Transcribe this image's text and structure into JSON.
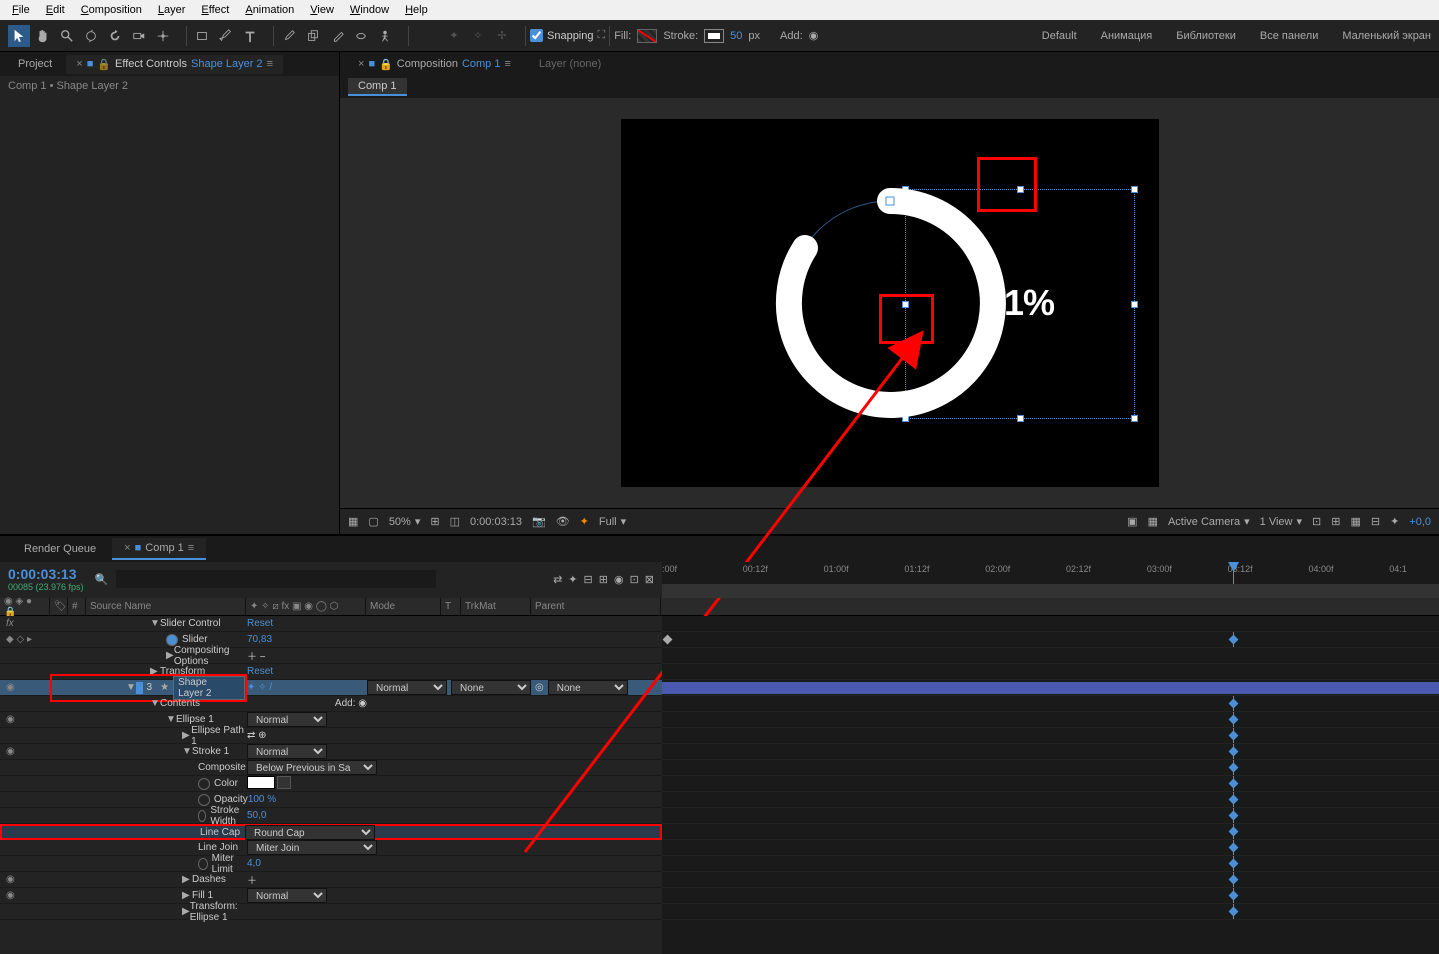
{
  "menu": [
    "File",
    "Edit",
    "Composition",
    "Layer",
    "Effect",
    "Animation",
    "View",
    "Window",
    "Help"
  ],
  "toolbar": {
    "snapping_label": "Snapping",
    "fill_label": "Fill:",
    "stroke_label": "Stroke:",
    "stroke_px": "50",
    "px_label": "px",
    "add_label": "Add:",
    "workspace_default": "Default",
    "ws": [
      "Анимация",
      "Библиотеки",
      "Все панели",
      "Маленький экран"
    ]
  },
  "project_panel": {
    "tabs": {
      "project": "Project",
      "effect_controls": "Effect Controls",
      "effect_target": "Shape Layer 2"
    },
    "subhead": "Comp 1 • Shape Layer 2"
  },
  "comp_panel": {
    "tab_prefix": "Composition",
    "comp_name": "Comp 1",
    "layer_none": "Layer (none)",
    "subtab": "Comp 1",
    "percent_text": "71%"
  },
  "viewer_footer": {
    "zoom": "50%",
    "timecode": "0:00:03:13",
    "res": "Full",
    "camera": "Active Camera",
    "view": "1 View",
    "exposure": "+0,0"
  },
  "timeline": {
    "tabs": {
      "render_queue": "Render Queue",
      "comp": "Comp 1"
    },
    "timecode": "0:00:03:13",
    "frames": "00085 (23.976 fps)",
    "search_placeholder": "",
    "cols": {
      "source_name": "Source Name",
      "mode": "Mode",
      "t": "T",
      "trkmat": "TrkMat",
      "parent": "Parent"
    },
    "ruler": [
      ":00f",
      "00:12f",
      "01:00f",
      "01:12f",
      "02:00f",
      "02:12f",
      "03:00f",
      "03:12f",
      "04:00f",
      "04:1"
    ],
    "rows": {
      "slider_control": "Slider Control",
      "reset": "Reset",
      "slider": "Slider",
      "slider_val": "70,83",
      "compositing": "Compositing Options",
      "transform": "Transform",
      "layer_num": "3",
      "layer_name": "Shape Layer 2",
      "mode_normal": "Normal",
      "mode_none": "None",
      "contents": "Contents",
      "add_label": "Add:",
      "ellipse1": "Ellipse 1",
      "ellipse_path": "Ellipse Path 1",
      "stroke1": "Stroke 1",
      "composite": "Composite",
      "composite_val": "Below Previous in Sa",
      "color": "Color",
      "opacity": "Opacity",
      "opacity_val": "100 %",
      "stroke_width": "Stroke Width",
      "stroke_width_val": "50,0",
      "line_cap": "Line Cap",
      "line_cap_val": "Round Cap",
      "line_join": "Line Join",
      "line_join_val": "Miter Join",
      "miter_limit": "Miter Limit",
      "miter_limit_val": "4,0",
      "dashes": "Dashes",
      "fill1": "Fill 1",
      "transform_ellipse": "Transform: Ellipse 1"
    }
  }
}
